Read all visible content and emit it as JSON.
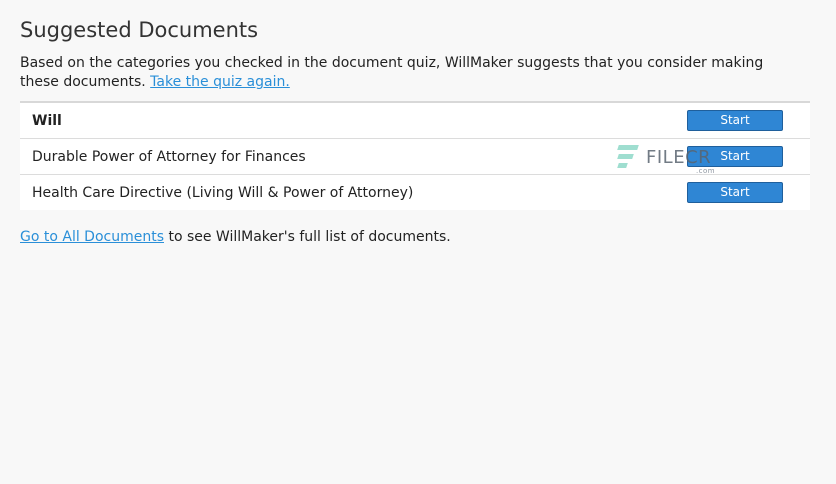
{
  "header": {
    "title": "Suggested Documents"
  },
  "intro": {
    "text": "Based on the categories you checked in the document quiz, WillMaker suggests that you consider making these documents. ",
    "quiz_link": "Take the quiz again."
  },
  "documents": [
    {
      "name": "Will",
      "button": "Start"
    },
    {
      "name": "Durable Power of Attorney for Finances",
      "button": "Start"
    },
    {
      "name": "Health Care Directive (Living Will & Power of Attorney)",
      "button": "Start"
    }
  ],
  "footer": {
    "link": "Go to All Documents",
    "text": " to see WillMaker's full list of documents."
  },
  "watermark": {
    "brand": "FILECR",
    "suffix": ".com"
  },
  "colors": {
    "accent": "#2f86d4",
    "link": "#2a8fd8",
    "background": "#f8f8f8"
  }
}
